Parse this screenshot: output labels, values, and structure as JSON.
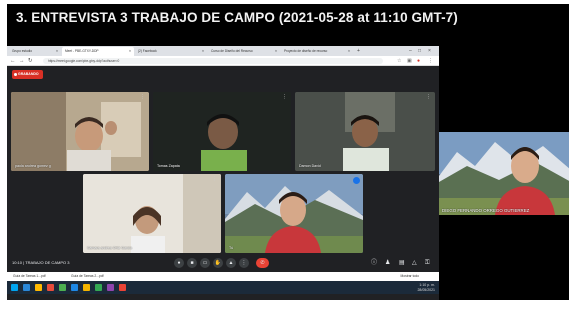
{
  "video_title": "3. ENTREVISTA 3 TRABAJO DE CAMPO (2021-05-28 at 11:10 GMT-7)",
  "browser": {
    "tabs": [
      {
        "label": "Grupo estudio",
        "active": false
      },
      {
        "label": "Meet - PBE-GTXY-DDP",
        "active": true
      },
      {
        "label": "(2) Facebook",
        "active": false
      },
      {
        "label": "Curso de Diseño del Recurso",
        "active": false
      },
      {
        "label": "Proyecto de diseño de recurso",
        "active": false
      }
    ],
    "url": "https://meet.google.com/pbe-gtxy-ddp?authuser=0",
    "recording_label": "GRABANDO"
  },
  "meet": {
    "participants": [
      {
        "name": "paola andrea gomez g"
      },
      {
        "name": "Tomas Zapata"
      },
      {
        "name": "Damon David"
      },
      {
        "name": "Samara andrea Ortiz Garcia"
      },
      {
        "name": "Tú"
      }
    ],
    "bottom_left": "10:10 | TRABAJO DE CAMPO 3",
    "controls": [
      "mic-icon",
      "camera-icon",
      "captions-icon",
      "raise-hand-icon",
      "present-icon",
      "more-icon",
      "end-call-icon"
    ],
    "right_controls": [
      "info-icon",
      "people-icon",
      "chat-icon",
      "activities-icon",
      "lock-icon"
    ]
  },
  "downloads": {
    "items": [
      {
        "label": "Guía de Tareas 1...pdf"
      },
      {
        "label": "Guía de Tareas 2...pdf"
      }
    ],
    "show_all": "Mostrar todo"
  },
  "taskbar": {
    "time": "1:10 p. m.",
    "date": "28/05/2021",
    "icon_colors": [
      "#2b88d8",
      "#ffb900",
      "#e74c3c",
      "#4caf50",
      "#1e88e5",
      "#f4b400",
      "#34a853",
      "#8e44ad",
      "#ea4335",
      "#00a4ef"
    ]
  },
  "presenter": {
    "name": "DIEGO FERNANDO ORREGO GUTIERREZ"
  },
  "colors": {
    "meet_bg": "#202124",
    "end_call": "#ea4335",
    "recording": "#d93025"
  }
}
